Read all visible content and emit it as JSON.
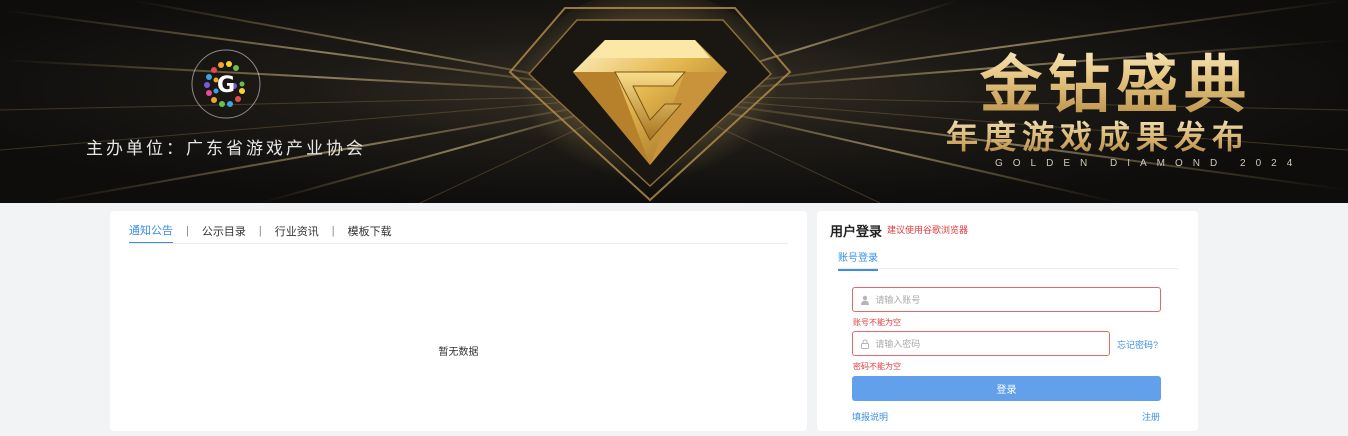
{
  "banner": {
    "organizer": "主办单位：广东省游戏产业协会",
    "title_main": "金钻盛典",
    "title_sub": "年度游戏成果发布",
    "title_en": "GOLDEN DIAMOND 2024",
    "logo_letter": "G",
    "colors": {
      "gold": "#d9b672",
      "bg": "#141210"
    }
  },
  "notice": {
    "tabs": [
      {
        "label": "通知公告",
        "active": true
      },
      {
        "label": "公示目录",
        "active": false
      },
      {
        "label": "行业资讯",
        "active": false
      },
      {
        "label": "模板下载",
        "active": false
      }
    ],
    "separator": "|",
    "empty_text": "暂无数据"
  },
  "login": {
    "title": "用户登录",
    "tip": "建议使用谷歌浏览器",
    "tab": "账号登录",
    "username": {
      "placeholder": "请输入账号",
      "value": "",
      "error": "账号不能为空",
      "icon": "user-icon"
    },
    "password": {
      "placeholder": "请输入密码",
      "value": "",
      "error": "密码不能为空",
      "icon": "lock-icon"
    },
    "forgot": "忘记密码?",
    "submit": "登录",
    "help": "填报说明",
    "register": "注册",
    "colors": {
      "accent": "#3a8ee6",
      "button": "#62a0ec",
      "error": "#e03b3b"
    }
  }
}
